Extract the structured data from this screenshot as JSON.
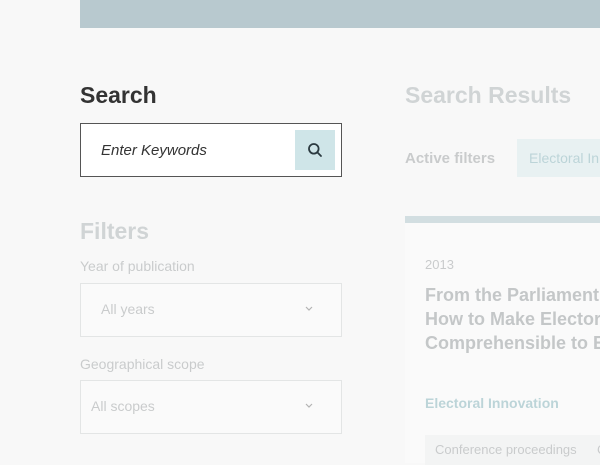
{
  "search": {
    "heading": "Search",
    "placeholder": "Enter Keywords",
    "button_icon": "search-icon"
  },
  "filters": {
    "heading": "Filters",
    "year": {
      "label": "Year of publication",
      "selected": "All years"
    },
    "scope": {
      "label": "Geographical scope",
      "selected": "All scopes"
    }
  },
  "results": {
    "heading": "Search Results",
    "active_filters_label": "Active filters",
    "active_filter_chip": "Electoral In",
    "card": {
      "year": "2013",
      "title": "From the Parliament\nHow to Make Electora\nComprehensible to El",
      "category": "Electoral Innovation",
      "tags": [
        "Conference proceedings",
        "C"
      ]
    }
  },
  "colors": {
    "top_bar": "#b8c9cf",
    "accent": "#cfe5e8",
    "background": "#f8f8f8"
  }
}
